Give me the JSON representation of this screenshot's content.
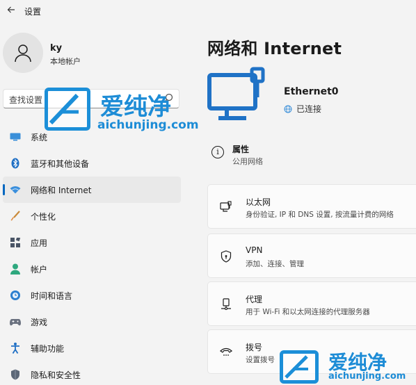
{
  "window": {
    "title": "设置"
  },
  "user": {
    "name": "ky",
    "account_type": "本地帐户"
  },
  "search": {
    "placeholder": "查找设置"
  },
  "sidebar": {
    "items": [
      {
        "label": "系统",
        "icon": "system-icon",
        "selected": false
      },
      {
        "label": "蓝牙和其他设备",
        "icon": "bluetooth-icon",
        "selected": false
      },
      {
        "label": "网络和 Internet",
        "icon": "wifi-icon",
        "selected": true
      },
      {
        "label": "个性化",
        "icon": "brush-icon",
        "selected": false
      },
      {
        "label": "应用",
        "icon": "apps-icon",
        "selected": false
      },
      {
        "label": "帐户",
        "icon": "person-icon",
        "selected": false
      },
      {
        "label": "时间和语言",
        "icon": "globe-clock-icon",
        "selected": false
      },
      {
        "label": "游戏",
        "icon": "gamepad-icon",
        "selected": false
      },
      {
        "label": "辅助功能",
        "icon": "accessibility-icon",
        "selected": false
      },
      {
        "label": "隐私和安全性",
        "icon": "shield-icon",
        "selected": false
      }
    ]
  },
  "main": {
    "title": "网络和 Internet",
    "adapter": {
      "name": "Ethernet0",
      "status": "已连接"
    },
    "properties": {
      "title": "属性",
      "subtitle": "公用网络"
    },
    "cards": [
      {
        "title": "以太网",
        "description": "身份验证, IP 和 DNS 设置, 按流量计费的网络",
        "icon": "ethernet-icon"
      },
      {
        "title": "VPN",
        "description": "添加、连接、管理",
        "icon": "vpn-shield-icon"
      },
      {
        "title": "代理",
        "description": "用于 Wi-Fi 和以太网连接的代理服务器",
        "icon": "proxy-icon"
      },
      {
        "title": "拨号",
        "description": "设置拨号",
        "icon": "dialup-icon"
      }
    ]
  },
  "watermark": {
    "brand": "爱纯净",
    "url": "aichunjing.com"
  },
  "colors": {
    "accent": "#0067c0",
    "watermark": "#1d8cd6",
    "background": "#f3f3f3"
  }
}
